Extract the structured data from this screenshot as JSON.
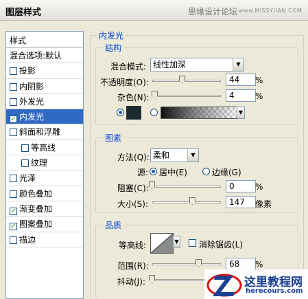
{
  "window": {
    "title": "图层样式"
  },
  "watermark": {
    "text": "思缘设计论坛",
    "url": "www.MISSYUAN.COM"
  },
  "styles_list": {
    "header": "样式",
    "items": [
      {
        "label": "混合选项:默认",
        "checkbox": false,
        "checked": false,
        "selected": false,
        "indent": false
      },
      {
        "label": "投影",
        "checkbox": true,
        "checked": false,
        "selected": false,
        "indent": false
      },
      {
        "label": "内阴影",
        "checkbox": true,
        "checked": false,
        "selected": false,
        "indent": false
      },
      {
        "label": "外发光",
        "checkbox": true,
        "checked": false,
        "selected": false,
        "indent": false
      },
      {
        "label": "内发光",
        "checkbox": true,
        "checked": true,
        "selected": true,
        "indent": false
      },
      {
        "label": "斜面和浮雕",
        "checkbox": true,
        "checked": false,
        "selected": false,
        "indent": false
      },
      {
        "label": "等高线",
        "checkbox": true,
        "checked": false,
        "selected": false,
        "indent": true
      },
      {
        "label": "纹理",
        "checkbox": true,
        "checked": false,
        "selected": false,
        "indent": true
      },
      {
        "label": "光泽",
        "checkbox": true,
        "checked": false,
        "selected": false,
        "indent": false
      },
      {
        "label": "颜色叠加",
        "checkbox": true,
        "checked": false,
        "selected": false,
        "indent": false
      },
      {
        "label": "渐变叠加",
        "checkbox": true,
        "checked": true,
        "selected": false,
        "indent": false
      },
      {
        "label": "图案叠加",
        "checkbox": true,
        "checked": true,
        "selected": false,
        "indent": false
      },
      {
        "label": "描边",
        "checkbox": true,
        "checked": false,
        "selected": false,
        "indent": false
      }
    ]
  },
  "panel": {
    "title": "内发光",
    "structure": {
      "title": "结构",
      "blend_mode_label": "混合模式:",
      "blend_mode_value": "线性加深",
      "opacity_label": "不透明度(O):",
      "opacity_value": "44",
      "opacity_level": 44,
      "noise_label": "杂色(N):",
      "noise_value": "4",
      "noise_level": 4,
      "percent": "%",
      "color_selected": "solid",
      "color_hex": "#1a2a2e"
    },
    "elements": {
      "title": "图素",
      "method_label": "方法(Q):",
      "method_value": "柔和",
      "source_label": "源:",
      "source_center": "居中(E)",
      "source_edge": "边缘(G)",
      "source_selected": "center",
      "choke_label": "阻塞(C):",
      "choke_value": "0",
      "choke_level": 0,
      "size_label": "大小(S):",
      "size_value": "147",
      "size_level": 147,
      "size_max": 250,
      "size_unit": "像素",
      "percent": "%"
    },
    "quality": {
      "title": "品质",
      "contour_label": "等高线:",
      "anti_alias_label": "消除锯齿(L)",
      "anti_alias_checked": false,
      "range_label": "范围(R):",
      "range_value": "68",
      "range_level": 68,
      "jitter_label": "抖动(J):",
      "jitter_level": 0,
      "percent": "%"
    }
  },
  "logo": {
    "text": "这里教程网",
    "url": "herecours.com"
  },
  "colors": {
    "selection": "#316ac5",
    "group_title": "#0046d5",
    "dialog_bg": "#ece9d8"
  }
}
